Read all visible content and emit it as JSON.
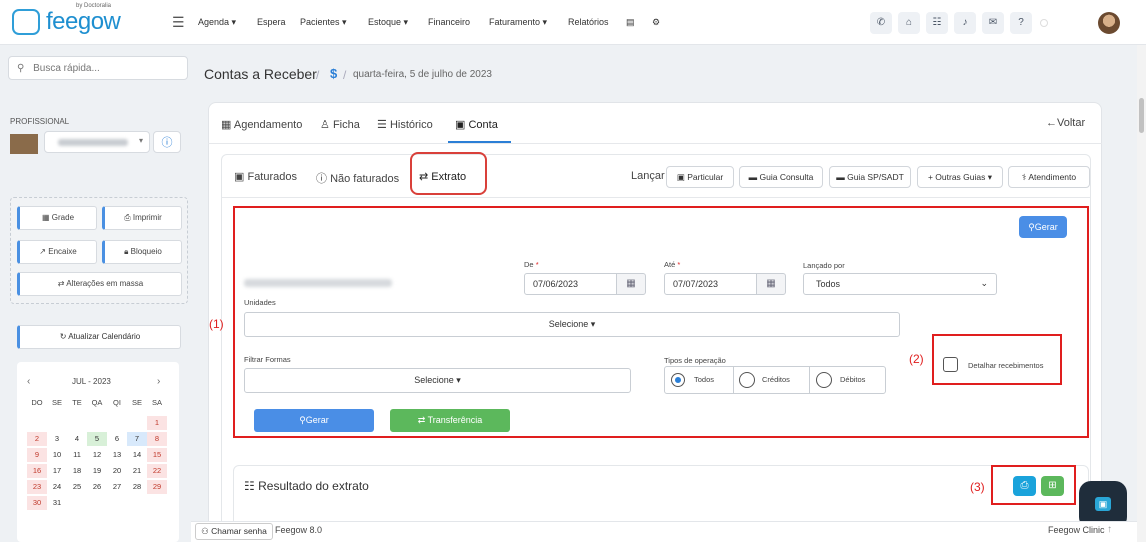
{
  "brand": {
    "name": "feegow",
    "sub": "by Doctoralia"
  },
  "nav": {
    "menu": [
      {
        "label": "Agenda ▾"
      },
      {
        "label": "Espera"
      },
      {
        "label": "Pacientes ▾"
      },
      {
        "label": "Estoque ▾"
      },
      {
        "label": "Financeiro"
      },
      {
        "label": "Faturamento ▾"
      },
      {
        "label": "Relatórios"
      }
    ]
  },
  "sidebar": {
    "search_placeholder": "Busca rápida...",
    "professional_label": "PROFISSIONAL",
    "buttons": {
      "grade": "Grade",
      "imprimir": "Imprimir",
      "encaixe": "Encaixe",
      "bloqueio": "Bloqueio",
      "alteracoes": "Alterações em massa"
    },
    "refresh": "Atualizar Calendário",
    "calendar": {
      "month": "JUL - 2023",
      "weekdays": [
        "DO",
        "SE",
        "TE",
        "QA",
        "QI",
        "SE",
        "SA"
      ],
      "rows": [
        [
          "",
          "",
          "",
          "",
          "",
          "",
          "1"
        ],
        [
          "2",
          "3",
          "4",
          "5",
          "6",
          "7",
          "8"
        ],
        [
          "9",
          "10",
          "11",
          "12",
          "13",
          "14",
          "15"
        ],
        [
          "16",
          "17",
          "18",
          "19",
          "20",
          "21",
          "22"
        ],
        [
          "23",
          "24",
          "25",
          "26",
          "27",
          "28",
          "29"
        ],
        [
          "30",
          "31",
          "",
          "",
          "",
          "",
          ""
        ]
      ]
    }
  },
  "breadcrumb": {
    "title": "Contas a Receber",
    "icon": "$",
    "date": "quarta-feira, 5 de julho de 2023"
  },
  "tabs_main": [
    {
      "label": "Agendamento"
    },
    {
      "label": "Ficha"
    },
    {
      "label": "Histórico"
    },
    {
      "label": "Conta"
    }
  ],
  "voltar": "Voltar",
  "tabs_sub": [
    {
      "label": "Faturados"
    },
    {
      "label": "Não faturados"
    },
    {
      "label": "Extrato"
    }
  ],
  "lancar": {
    "label": "Lançar",
    "buttons": [
      "Particular",
      "Guia Consulta",
      "Guia SP/SADT",
      "Outras Guias",
      "Atendimento"
    ]
  },
  "form": {
    "gerar_top": "Gerar",
    "de_label": "De",
    "de_value": "07/06/2023",
    "ate_label": "Até",
    "ate_value": "07/07/2023",
    "lancado_label": "Lançado por",
    "lancado_value": "Todos",
    "unidades_label": "Unidades",
    "unidades_value": "Selecione",
    "formas_label": "Filtrar Formas",
    "formas_value": "Selecione",
    "tipos_label": "Tipos de operação",
    "tipos": [
      "Todos",
      "Créditos",
      "Débitos"
    ],
    "detalhar": "Detalhar recebimentos",
    "gerar": "Gerar",
    "transferencia": "Transferência"
  },
  "annotations": {
    "a1": "(1)",
    "a2": "(2)",
    "a3": "(3)"
  },
  "result": {
    "title": "Resultado do extrato"
  },
  "footer": {
    "chamar": "Chamar senha",
    "version": "Feegow 8.0",
    "right": "Feegow Clinic"
  },
  "colors": {
    "primary": "#2b7fd6",
    "success": "#5cb85c",
    "annotation": "#e01e1e",
    "info": "#1aa3db"
  }
}
